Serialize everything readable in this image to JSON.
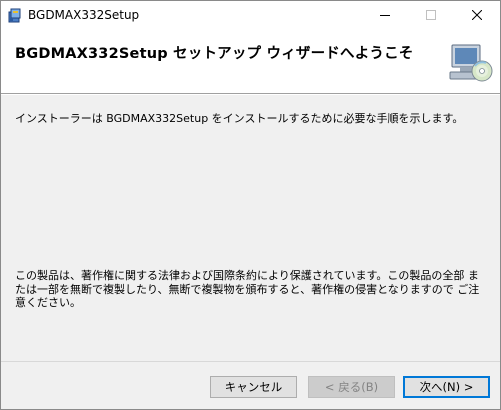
{
  "window": {
    "title": "BGDMAX332Setup",
    "icon": "installer-package-icon",
    "controls": {
      "minimize_icon": "minimize-icon",
      "maximize_icon": "maximize-icon",
      "close_icon": "close-icon"
    }
  },
  "banner": {
    "title": "BGDMAX332Setup セットアップ ウィザードへようこそ",
    "art_icon": "computer-disc-icon"
  },
  "content": {
    "intro": "インストーラーは BGDMAX332Setup をインストールするために必要な手順を示します。",
    "legal": "この製品は、著作権に関する法律および国際条約により保護されています。この製品の全部 または一部を無断で複製したり、無断で複製物を頒布すると、著作権の侵害となりますので ご注意ください。"
  },
  "buttons": {
    "cancel": "キャンセル",
    "back": "< 戻る(B)",
    "next": "次へ(N) >"
  },
  "colors": {
    "dialog_background": "#f0f0f0",
    "focus_border": "#0078d7",
    "disabled_text": "#838383"
  }
}
